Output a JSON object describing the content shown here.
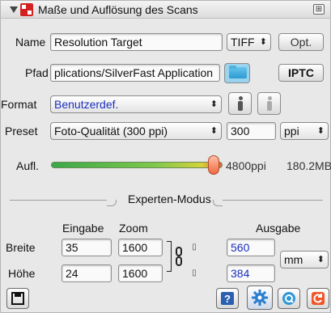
{
  "header": {
    "title": "Maße und Auflösung des Scans",
    "menu_glyph": "⊞"
  },
  "name_row": {
    "label": "Name",
    "value": "Resolution Target",
    "format": "TIFF",
    "opt_label": "Opt."
  },
  "path_row": {
    "label": "Pfad",
    "value": "plications/SilverFast Application",
    "iptc_label": "IPTC"
  },
  "format_row": {
    "label": "Format",
    "value": "Benutzerdef."
  },
  "preset_row": {
    "label": "Preset",
    "value": "Foto-Qualität (300 ppi)",
    "resolution": "300",
    "unit": "ppi"
  },
  "aufl_row": {
    "label": "Aufl.",
    "ppi": "4800ppi",
    "size": "180.2MB",
    "slider_level": 0.95
  },
  "expert": {
    "title": "Experten-Modus"
  },
  "grid": {
    "col_input": "Eingabe",
    "col_zoom": "Zoom",
    "col_output": "Ausgabe",
    "row_width": {
      "label": "Breite",
      "input": "35",
      "zoom": "1600",
      "output": "560"
    },
    "row_height": {
      "label": "Höhe",
      "input": "24",
      "zoom": "1600",
      "output": "384"
    },
    "unit": "mm"
  },
  "icons": {
    "save": "save-icon",
    "help": "help-icon",
    "settings": "gear-icon",
    "q": "q-icon",
    "reset": "reset-icon"
  },
  "colors": {
    "accent_blue": "#1a2fc0",
    "reset_orange": "#f0562a",
    "gear_blue": "#2b7fd0"
  }
}
